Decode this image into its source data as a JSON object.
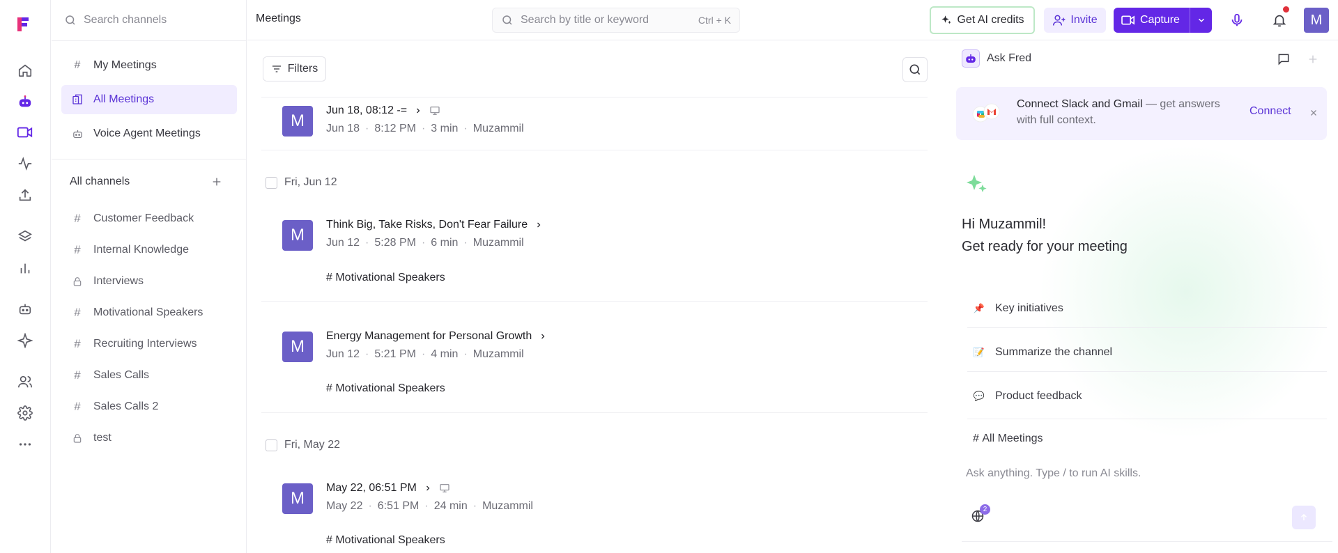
{
  "sidebar": {
    "search_placeholder": "Search channels",
    "nav": [
      {
        "label": "My Meetings",
        "icon": "hash-icon"
      },
      {
        "label": "All Meetings",
        "icon": "folder-icon",
        "active": true
      },
      {
        "label": "Voice Agent Meetings",
        "icon": "bot-icon"
      }
    ],
    "all_channels_label": "All channels",
    "channels": [
      {
        "label": "Customer Feedback",
        "icon": "hash-icon"
      },
      {
        "label": "Internal Knowledge",
        "icon": "hash-icon"
      },
      {
        "label": "Interviews",
        "icon": "lock-icon"
      },
      {
        "label": "Motivational Speakers",
        "icon": "hash-icon"
      },
      {
        "label": "Recruiting Interviews",
        "icon": "hash-icon"
      },
      {
        "label": "Sales Calls",
        "icon": "hash-icon"
      },
      {
        "label": "Sales Calls 2",
        "icon": "hash-icon"
      },
      {
        "label": "test",
        "icon": "lock-icon"
      }
    ]
  },
  "topbar": {
    "title": "Meetings",
    "search_placeholder": "Search by title or keyword",
    "shortcut": "Ctrl + K",
    "credits_label": "Get AI credits",
    "invite_label": "Invite",
    "capture_label": "Capture",
    "avatar_letter": "M"
  },
  "list": {
    "filters_label": "Filters",
    "groups": [
      {
        "date": "",
        "meetings": [
          {
            "avatar": "M",
            "title": "Jun 18, 08:12 -=",
            "date": "Jun 18",
            "time": "8:12 PM",
            "duration": "3 min",
            "owner": "Muzammil",
            "tag": "",
            "has_screen_icon": true
          }
        ]
      },
      {
        "date": "Fri, Jun 12",
        "meetings": [
          {
            "avatar": "M",
            "title": "Think Big, Take Risks, Don't Fear Failure",
            "date": "Jun 12",
            "time": "5:28 PM",
            "duration": "6 min",
            "owner": "Muzammil",
            "tag": "Motivational Speakers"
          },
          {
            "avatar": "M",
            "title": "Energy Management for Personal Growth",
            "date": "Jun 12",
            "time": "5:21 PM",
            "duration": "4 min",
            "owner": "Muzammil",
            "tag": "Motivational Speakers"
          }
        ]
      },
      {
        "date": "Fri, May 22",
        "meetings": [
          {
            "avatar": "M",
            "title": "May 22, 06:51 PM",
            "date": "May 22",
            "time": "6:51 PM",
            "duration": "24 min",
            "owner": "Muzammil",
            "tag": "Motivational Speakers",
            "has_screen_icon": true
          }
        ]
      }
    ]
  },
  "panel": {
    "title": "Ask Fred",
    "connect_bold": "Connect Slack and Gmail",
    "connect_rest": " — get answers with full context.",
    "connect_button": "Connect",
    "greeting": "Hi Muzammil!",
    "subgreeting": "Get ready for your meeting",
    "suggestions": [
      {
        "label": "Key initiatives",
        "emoji": "📌"
      },
      {
        "label": "Summarize the channel",
        "emoji": "📝"
      },
      {
        "label": "Product feedback",
        "emoji": "💬"
      }
    ],
    "channel_tag": "All Meetings",
    "input_placeholder": "Ask anything. Type / to run AI skills.",
    "badge_count": "2"
  },
  "colors": {
    "accent": "#6327e6",
    "accent_light": "#f1edff",
    "avatar": "#6b5fc7",
    "notification": "#e0303a"
  }
}
